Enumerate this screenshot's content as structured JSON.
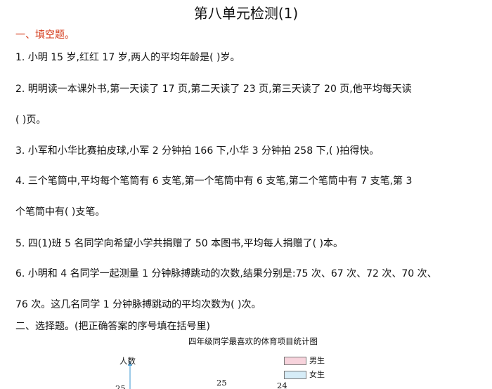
{
  "title": "第八单元检测(1)",
  "section1": "一、填空题。",
  "questions": [
    "1. 小明 15 岁,红红 17 岁,两人的平均年龄是(        )岁。",
    "2. 明明读一本课外书,第一天读了 17 页,第二天读了 23 页,第三天读了 20 页,他平均每天读",
    "(        )页。",
    "3. 小军和小华比赛拍皮球,小军 2 分钟拍 166 下,小华 3 分钟拍 258 下,(        )拍得快。",
    "4. 三个笔筒中,平均每个笔筒有 6 支笔,第一个笔筒中有 6 支笔,第二个笔筒中有 7 支笔,第 3",
    "个笔筒中有(        )支笔。",
    "5. 四(1)班 5 名同学向希望小学共捐赠了 50 本图书,平均每人捐赠了(        )本。",
    "6. 小明和 4 名同学一起测量 1 分钟脉搏跳动的次数,结果分别是:75 次、67 次、72 次、70 次、",
    "76 次。这几名同学 1 分钟脉搏跳动的平均次数为(        )次。"
  ],
  "section2": "二、选择题。(把正确答案的序号填在括号里)",
  "chart_data": {
    "type": "bar",
    "title": "四年级同学最喜欢的体育项目统计图",
    "ylabel": "人数",
    "series": [
      {
        "name": "男生",
        "color": "#f7d3dc"
      },
      {
        "name": "女生",
        "color": "#d6ecf7"
      }
    ],
    "visible_labels": [
      "25",
      "25",
      "24"
    ],
    "axis_color": "#5ba8d8"
  }
}
